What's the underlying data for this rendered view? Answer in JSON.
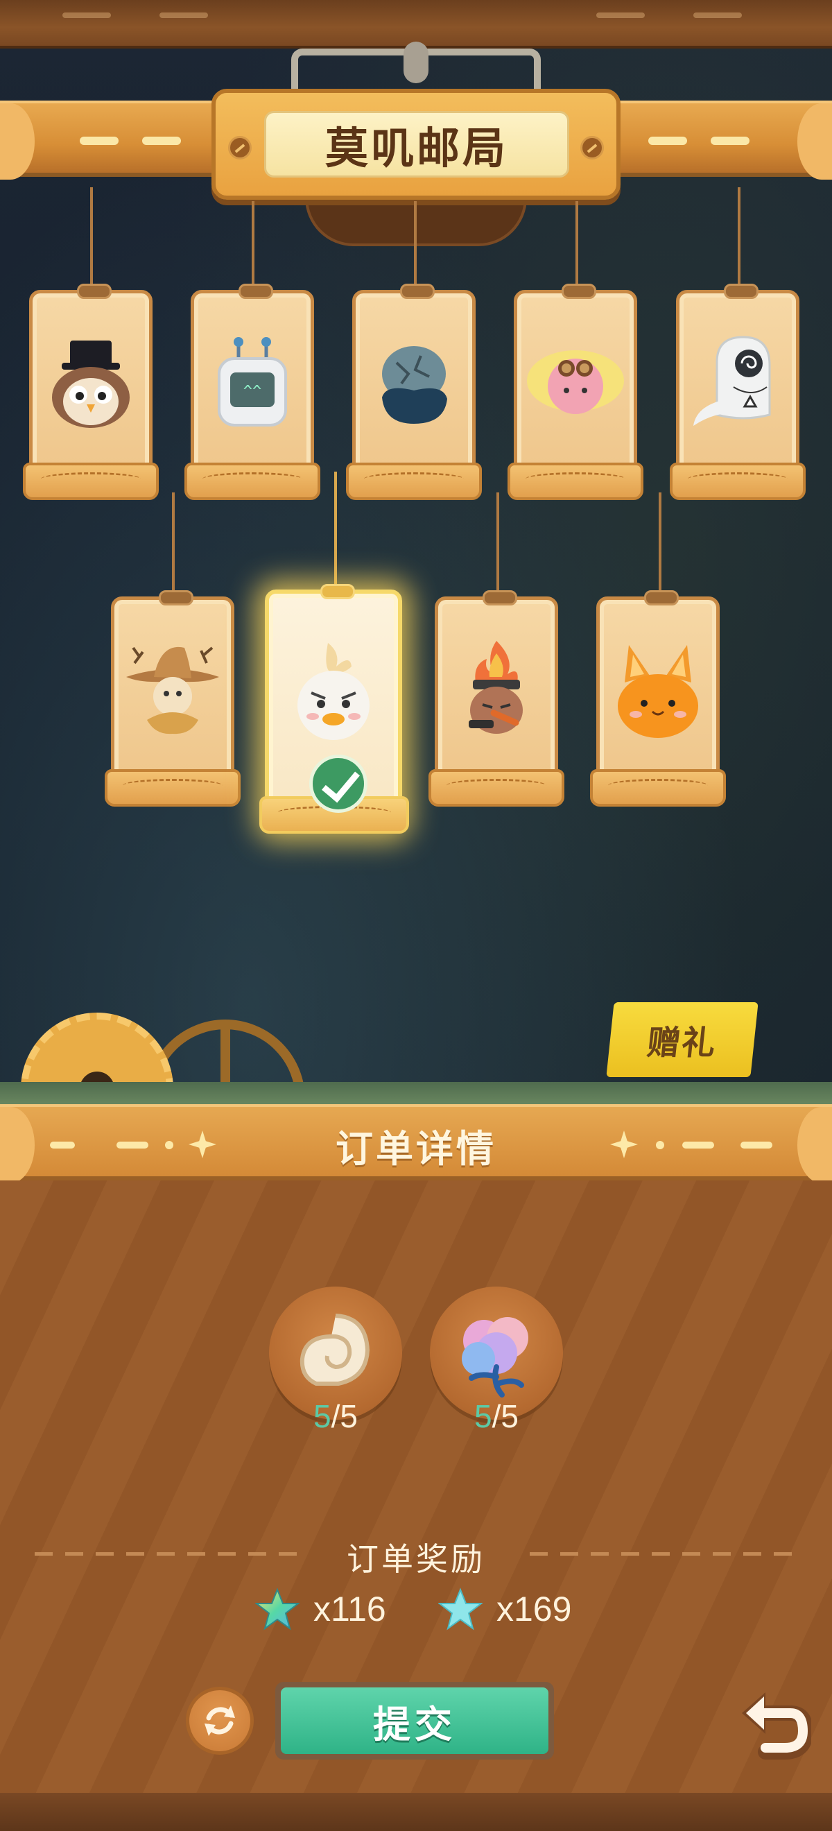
{
  "header": {
    "title": "莫叽邮局"
  },
  "cards": {
    "row1": [
      {
        "name": "owl-top-hat",
        "selected": false
      },
      {
        "name": "robot-screen",
        "selected": false
      },
      {
        "name": "cracked-stone",
        "selected": false
      },
      {
        "name": "pink-bird-goggles",
        "selected": false
      },
      {
        "name": "ghost-swirl",
        "selected": false
      }
    ],
    "row2": [
      {
        "name": "scarecrow",
        "selected": false
      },
      {
        "name": "white-duck",
        "selected": true
      },
      {
        "name": "campfire-creature",
        "selected": false
      },
      {
        "name": "orange-fox",
        "selected": false
      }
    ]
  },
  "gift": {
    "label": "赠礼"
  },
  "order": {
    "section_title": "订单详情",
    "items": [
      {
        "icon": "shell-icon",
        "have": "5",
        "sep": "/",
        "need": "5"
      },
      {
        "icon": "blue-flower-icon",
        "have": "5",
        "sep": "/",
        "need": "5"
      }
    ],
    "reward_title": "订单奖励",
    "rewards": [
      {
        "icon": "gradient-star-icon",
        "amount": "x116"
      },
      {
        "icon": "blue-star-icon",
        "amount": "x169"
      }
    ]
  },
  "actions": {
    "submit_label": "提交",
    "refresh_icon": "refresh-icon",
    "back_icon": "back-arrow-icon"
  },
  "colors": {
    "have_count": "#5cc9a5",
    "submit": "#2fb387",
    "selected_glow": "#f6d96a"
  }
}
